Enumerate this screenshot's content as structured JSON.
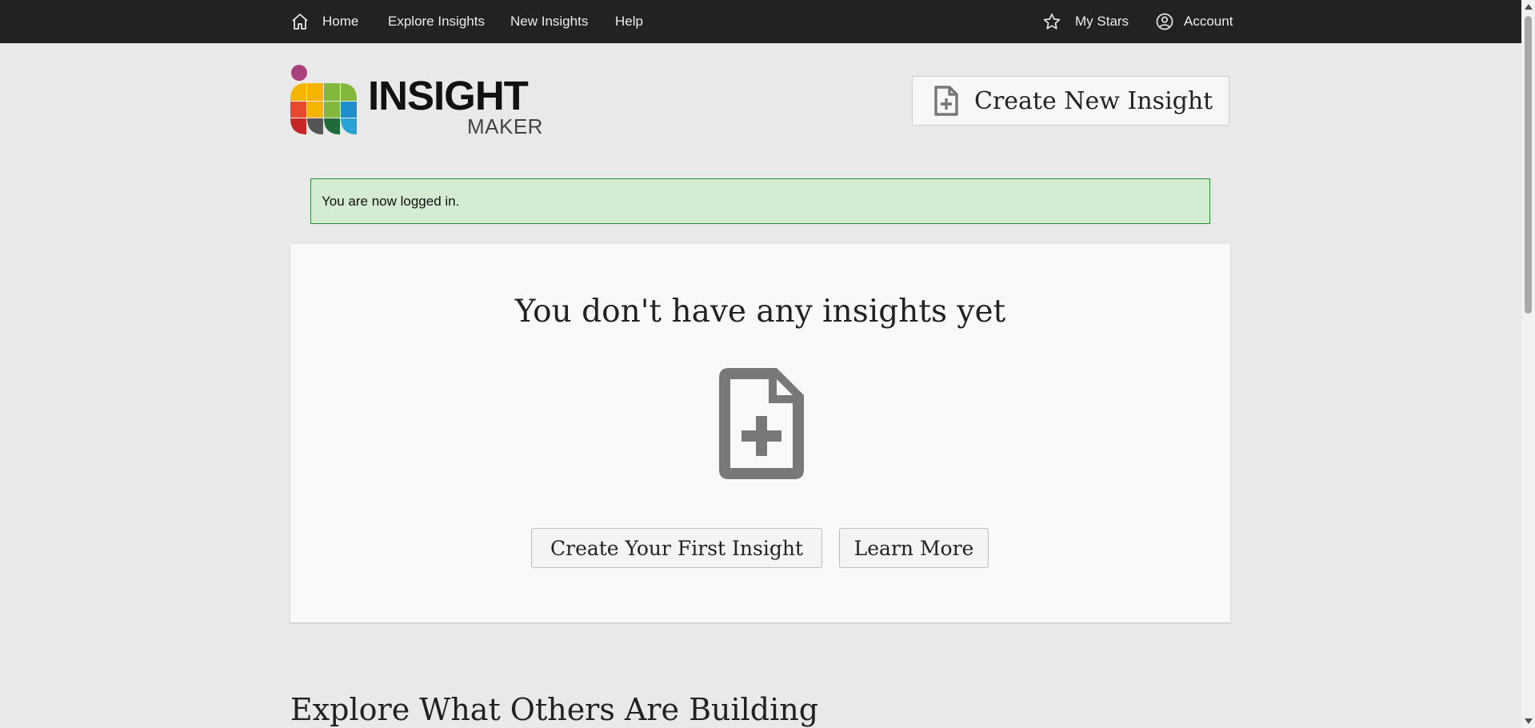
{
  "nav": {
    "home": "Home",
    "explore": "Explore Insights",
    "new_insights": "New Insights",
    "help": "Help",
    "my_stars": "My Stars",
    "account": "Account"
  },
  "logo": {
    "word": "INSIGHT",
    "sub": "MAKER",
    "colors": [
      "#a8417d",
      "#f4b400",
      "#e6492d",
      "#84b83c",
      "#1e8fcb",
      "#c62828",
      "#555555",
      "#1f6b3a",
      "#29a3d6"
    ]
  },
  "header": {
    "create_button": "Create New Insight"
  },
  "flash": {
    "message": "You are now logged in."
  },
  "empty_state": {
    "title": "You don't have any insights yet",
    "create_first": "Create Your First Insight",
    "learn_more": "Learn More"
  },
  "explore": {
    "heading": "Explore What Others Are Building"
  },
  "icons": [
    "home-icon",
    "star-icon",
    "account-icon",
    "file-plus-icon"
  ]
}
